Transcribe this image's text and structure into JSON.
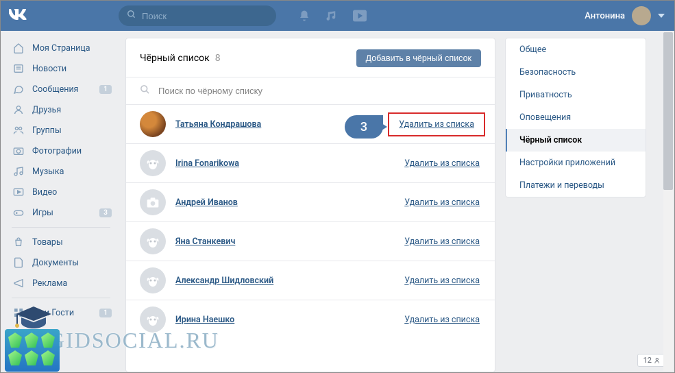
{
  "topbar": {
    "search_placeholder": "Поиск",
    "username": "Антонина"
  },
  "leftnav": {
    "items": [
      {
        "icon": "home",
        "label": "Моя Страница",
        "badge": null
      },
      {
        "icon": "news",
        "label": "Новости",
        "badge": null
      },
      {
        "icon": "msg",
        "label": "Сообщения",
        "badge": "1"
      },
      {
        "icon": "friends",
        "label": "Друзья",
        "badge": null
      },
      {
        "icon": "groups",
        "label": "Группы",
        "badge": null
      },
      {
        "icon": "photo",
        "label": "Фотографии",
        "badge": null
      },
      {
        "icon": "music",
        "label": "Музыка",
        "badge": null
      },
      {
        "icon": "video",
        "label": "Видео",
        "badge": null
      },
      {
        "icon": "games",
        "label": "Игры",
        "badge": "3"
      }
    ],
    "items2": [
      {
        "icon": "market",
        "label": "Товары",
        "badge": null
      },
      {
        "icon": "docs",
        "label": "Документы",
        "badge": null
      },
      {
        "icon": "ads",
        "label": "Реклама",
        "badge": null
      }
    ],
    "items3": [
      {
        "icon": "apps",
        "label": "Мои Гости",
        "badge": "1"
      }
    ]
  },
  "blacklist": {
    "title": "Чёрный список",
    "count": "8",
    "add_btn": "Добавить в чёрный список",
    "search_placeholder": "Поиск по чёрному списку",
    "remove_label": "Удалить из списка",
    "items": [
      {
        "name": "Татьяна Кондрашова",
        "ava": "photo",
        "highlight": true
      },
      {
        "name": "Irina Fonarikowa",
        "ava": "dog",
        "highlight": false
      },
      {
        "name": "Андрей Иванов",
        "ava": "cam",
        "highlight": false
      },
      {
        "name": "Яна Станкевич",
        "ava": "dog",
        "highlight": false
      },
      {
        "name": "Александр Шидловский",
        "ava": "dog",
        "highlight": false
      },
      {
        "name": "Ирина Наешко",
        "ava": "dog",
        "highlight": false
      }
    ]
  },
  "sidemenu": {
    "items": [
      "Общее",
      "Безопасность",
      "Приватность",
      "Оповещения",
      "Чёрный список",
      "Настройки приложений",
      "Платежи и переводы"
    ],
    "active_index": 4
  },
  "marker": {
    "label": "3"
  },
  "watermark": "GIDSOCIAL.RU",
  "bottom_badge": "12"
}
